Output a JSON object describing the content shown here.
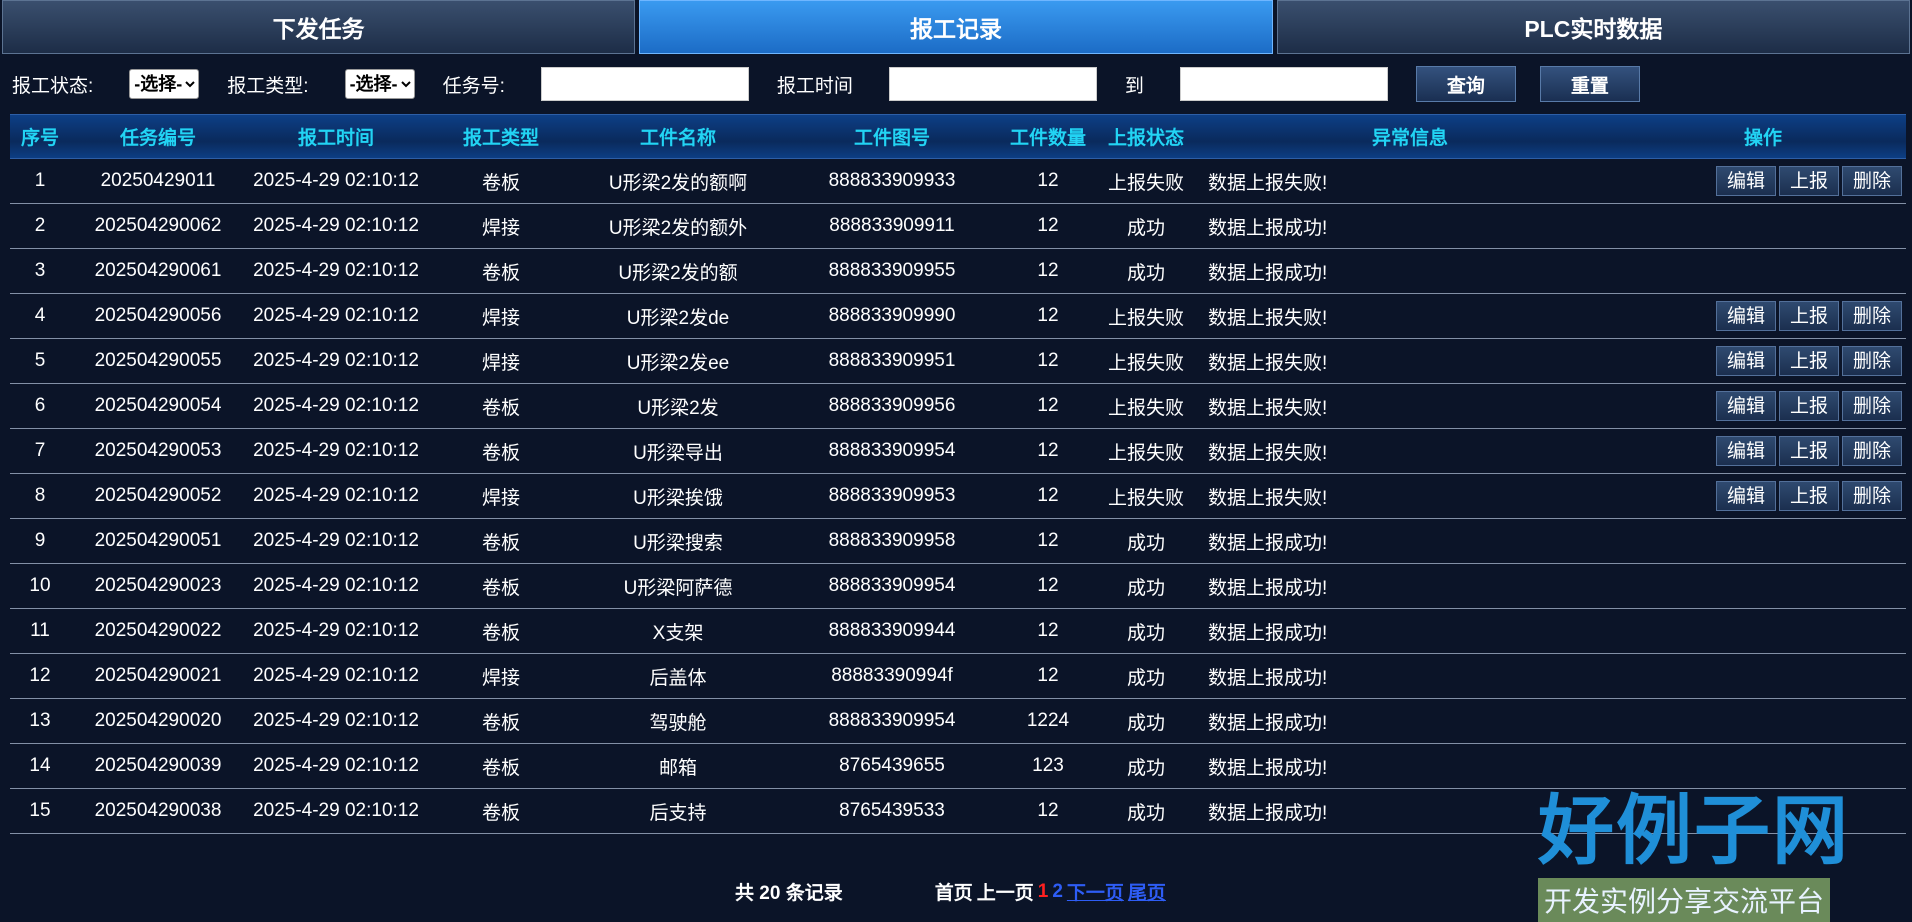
{
  "tabs": [
    "下发任务",
    "报工记录",
    "PLC实时数据"
  ],
  "filters": {
    "status_label": "报工状态:",
    "status_value": "-选择-",
    "type_label": "报工类型:",
    "type_value": "-选择-",
    "task_label": "任务号:",
    "time_label": "报工时间",
    "to_label": "到",
    "query_label": "查询",
    "reset_label": "重置"
  },
  "table": {
    "headers": [
      "序号",
      "任务编号",
      "报工时间",
      "报工类型",
      "工件名称",
      "工件图号",
      "工件数量",
      "上报状态",
      "异常信息",
      "操作"
    ],
    "action_labels": [
      "编辑",
      "上报",
      "删除"
    ],
    "rows": [
      {
        "no": "1",
        "task": "20250429011",
        "time": "2025-4-29 02:10:12",
        "type": "卷板",
        "name": "U形梁2发的额啊",
        "drawing": "888833909933",
        "qty": "12",
        "status": "上报失败",
        "msg": "数据上报失败!",
        "actions": true
      },
      {
        "no": "2",
        "task": "202504290062",
        "time": "2025-4-29 02:10:12",
        "type": "焊接",
        "name": "U形梁2发的额外",
        "drawing": "888833909911",
        "qty": "12",
        "status": "成功",
        "msg": "数据上报成功!",
        "actions": false
      },
      {
        "no": "3",
        "task": "202504290061",
        "time": "2025-4-29 02:10:12",
        "type": "卷板",
        "name": "U形梁2发的额",
        "drawing": "888833909955",
        "qty": "12",
        "status": "成功",
        "msg": "数据上报成功!",
        "actions": false
      },
      {
        "no": "4",
        "task": "202504290056",
        "time": "2025-4-29 02:10:12",
        "type": "焊接",
        "name": "U形梁2发de",
        "drawing": "888833909990",
        "qty": "12",
        "status": "上报失败",
        "msg": "数据上报失败!",
        "actions": true
      },
      {
        "no": "5",
        "task": "202504290055",
        "time": "2025-4-29 02:10:12",
        "type": "焊接",
        "name": "U形梁2发ee",
        "drawing": "888833909951",
        "qty": "12",
        "status": "上报失败",
        "msg": "数据上报失败!",
        "actions": true
      },
      {
        "no": "6",
        "task": "202504290054",
        "time": "2025-4-29 02:10:12",
        "type": "卷板",
        "name": "U形梁2发",
        "drawing": "888833909956",
        "qty": "12",
        "status": "上报失败",
        "msg": "数据上报失败!",
        "actions": true
      },
      {
        "no": "7",
        "task": "202504290053",
        "time": "2025-4-29 02:10:12",
        "type": "卷板",
        "name": "U形梁导出",
        "drawing": "888833909954",
        "qty": "12",
        "status": "上报失败",
        "msg": "数据上报失败!",
        "actions": true
      },
      {
        "no": "8",
        "task": "202504290052",
        "time": "2025-4-29 02:10:12",
        "type": "焊接",
        "name": "U形梁挨饿",
        "drawing": "888833909953",
        "qty": "12",
        "status": "上报失败",
        "msg": "数据上报失败!",
        "actions": true
      },
      {
        "no": "9",
        "task": "202504290051",
        "time": "2025-4-29 02:10:12",
        "type": "卷板",
        "name": "U形梁搜索",
        "drawing": "888833909958",
        "qty": "12",
        "status": "成功",
        "msg": "数据上报成功!",
        "actions": false
      },
      {
        "no": "10",
        "task": "202504290023",
        "time": "2025-4-29 02:10:12",
        "type": "卷板",
        "name": "U形梁阿萨德",
        "drawing": "888833909954",
        "qty": "12",
        "status": "成功",
        "msg": "数据上报成功!",
        "actions": false
      },
      {
        "no": "11",
        "task": "202504290022",
        "time": "2025-4-29 02:10:12",
        "type": "卷板",
        "name": "X支架",
        "drawing": "888833909944",
        "qty": "12",
        "status": "成功",
        "msg": "数据上报成功!",
        "actions": false
      },
      {
        "no": "12",
        "task": "202504290021",
        "time": "2025-4-29 02:10:12",
        "type": "焊接",
        "name": "后盖体",
        "drawing": "88883390994f",
        "qty": "12",
        "status": "成功",
        "msg": "数据上报成功!",
        "actions": false
      },
      {
        "no": "13",
        "task": "202504290020",
        "time": "2025-4-29 02:10:12",
        "type": "卷板",
        "name": "驾驶舱",
        "drawing": "888833909954",
        "qty": "1224",
        "status": "成功",
        "msg": "数据上报成功!",
        "actions": false
      },
      {
        "no": "14",
        "task": "202504290039",
        "time": "2025-4-29 02:10:12",
        "type": "卷板",
        "name": "邮箱",
        "drawing": "8765439655",
        "qty": "123",
        "status": "成功",
        "msg": "数据上报成功!",
        "actions": false
      },
      {
        "no": "15",
        "task": "202504290038",
        "time": "2025-4-29 02:10:12",
        "type": "卷板",
        "name": "后支持",
        "drawing": "8765439533",
        "qty": "12",
        "status": "成功",
        "msg": "数据上报成功!",
        "actions": false
      }
    ]
  },
  "pager": {
    "total": "共 20 条记录",
    "first": "首页",
    "prev": "上一页",
    "current": "1",
    "page2": "2",
    "next": "下一页",
    "last": "尾页"
  },
  "watermark": {
    "big": "好例子网",
    "small": "开发实例分享交流平台"
  }
}
